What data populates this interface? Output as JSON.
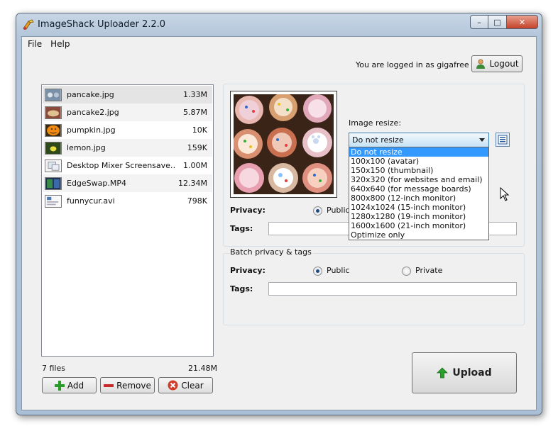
{
  "window": {
    "title": "ImageShack Uploader 2.2.0"
  },
  "menu": {
    "items": [
      "File",
      "Help"
    ]
  },
  "account": {
    "status_text": "You are logged in as gigafree",
    "logout_label": "Logout"
  },
  "files": {
    "items": [
      {
        "name": "pancake.jpg",
        "size": "1.33M"
      },
      {
        "name": "pancake2.jpg",
        "size": "5.87M"
      },
      {
        "name": "pumpkin.jpg",
        "size": "10K"
      },
      {
        "name": "lemon.jpg",
        "size": "159K"
      },
      {
        "name": "Desktop Mixer Screensave…",
        "size": "1.00M"
      },
      {
        "name": "EdgeSwap.MP4",
        "size": "12.34M"
      },
      {
        "name": "funnycur.avi",
        "size": "798K"
      }
    ],
    "count_text": "7 files",
    "total_size": "21.48M"
  },
  "file_buttons": {
    "add": "Add",
    "remove": "Remove",
    "clear": "Clear"
  },
  "single": {
    "resize_label": "Image resize:",
    "resize_selected": "Do not resize",
    "resize_options": [
      "Do not resize",
      "100x100 (avatar)",
      "150x150 (thumbnail)",
      "320x320 (for websites and email)",
      "640x640 (for message boards)",
      "800x800 (12-inch monitor)",
      "1024x1024 (15-inch monitor)",
      "1280x1280 (19-inch monitor)",
      "1600x1600 (21-inch monitor)",
      "Optimize only"
    ],
    "privacy_label": "Privacy:",
    "public_label": "Public",
    "tags_label": "Tags:"
  },
  "batch": {
    "title": "Batch privacy & tags",
    "privacy_label": "Privacy:",
    "public_label": "Public",
    "private_label": "Private",
    "tags_label": "Tags:"
  },
  "upload": {
    "label": "Upload"
  },
  "colors": {
    "title_gradient": "#b4c6da",
    "selection": "#3399ff",
    "select_border": "#3c7fb1"
  }
}
